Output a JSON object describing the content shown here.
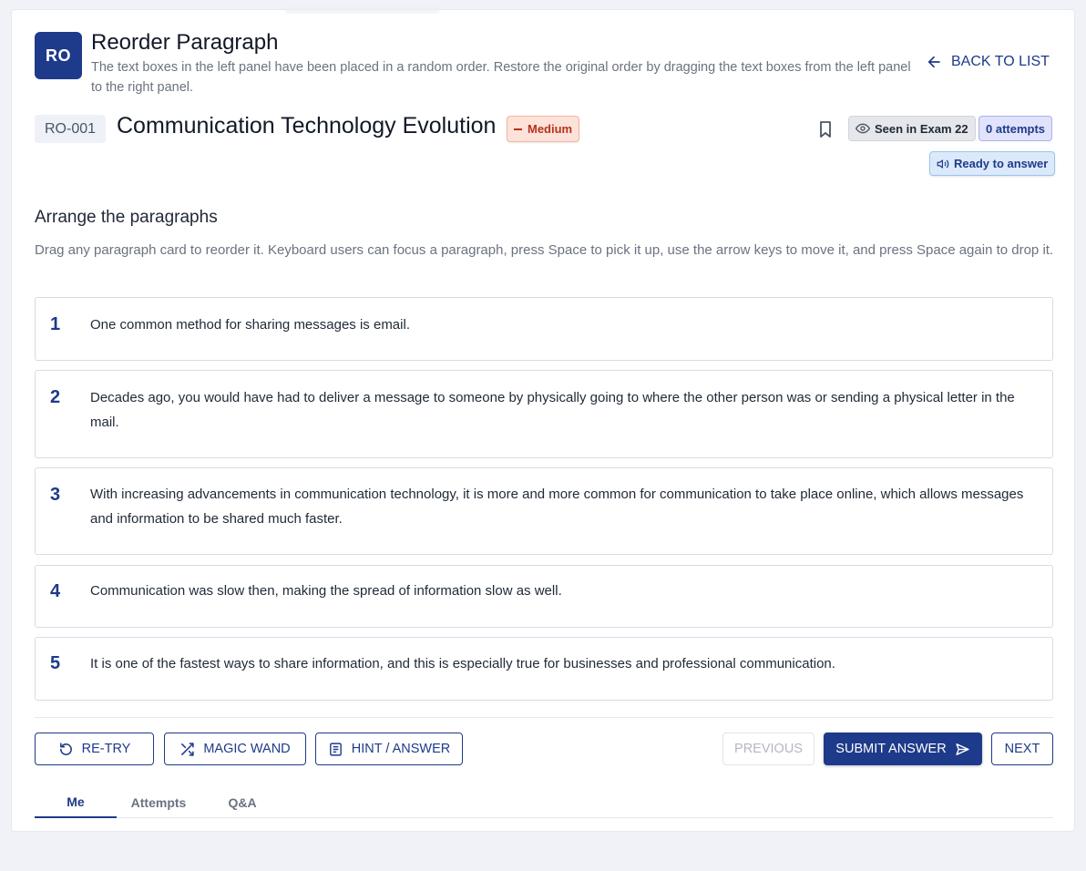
{
  "header": {
    "logo_text": "RO",
    "task_title": "Reorder Paragraph",
    "task_description": "The text boxes in the left panel have been placed in a random order. Restore the original order by dragging the text boxes from the left panel to the right panel.",
    "back_label": "BACK TO LIST"
  },
  "question": {
    "id": "RO-001",
    "title": "Communication Technology Evolution",
    "difficulty": "Medium",
    "seen_label": "Seen in Exam 22",
    "attempts_label": "0 attempts",
    "status_label": "Ready to answer"
  },
  "arrange": {
    "heading": "Arrange the paragraphs",
    "instructions": "Drag any paragraph card to reorder it. Keyboard users can focus a paragraph, press Space to pick it up, use the arrow keys to move it, and press Space again to drop it."
  },
  "paragraphs": [
    {
      "number": "1",
      "text": "One common method for sharing messages is email."
    },
    {
      "number": "2",
      "text": "Decades ago, you would have had to deliver a message to someone by physically going to where the other person was or sending a physical letter in the mail."
    },
    {
      "number": "3",
      "text": "With increasing advancements in communication technology, it is more and more common for communication to take place online, which allows messages and information to be shared much faster."
    },
    {
      "number": "4",
      "text": "Communication was slow then, making the spread of information slow as well."
    },
    {
      "number": "5",
      "text": "It is one of the fastest ways to share information, and this is especially true for businesses and professional communication."
    }
  ],
  "actions": {
    "retry": "RE-TRY",
    "magic_wand": "MAGIC WAND",
    "hint": "HINT / ANSWER",
    "previous": "PREVIOUS",
    "submit": "SUBMIT ANSWER",
    "next": "NEXT"
  },
  "tabs": [
    {
      "label": "Me",
      "active": true
    },
    {
      "label": "Attempts",
      "active": false
    },
    {
      "label": "Q&A",
      "active": false
    }
  ],
  "colors": {
    "primary": "#1e3a8a",
    "medium_badge_bg": "#fde2da",
    "medium_badge_text": "#b4341a",
    "page_bg": "#f0f2f8"
  },
  "icons": {
    "back": "arrow-left-icon",
    "bookmark": "bookmark-icon",
    "seen": "eye-icon",
    "status": "speaker-icon",
    "retry": "rotate-ccw-icon",
    "magic_wand": "shuffle-icon",
    "hint": "document-icon",
    "submit": "send-icon"
  }
}
